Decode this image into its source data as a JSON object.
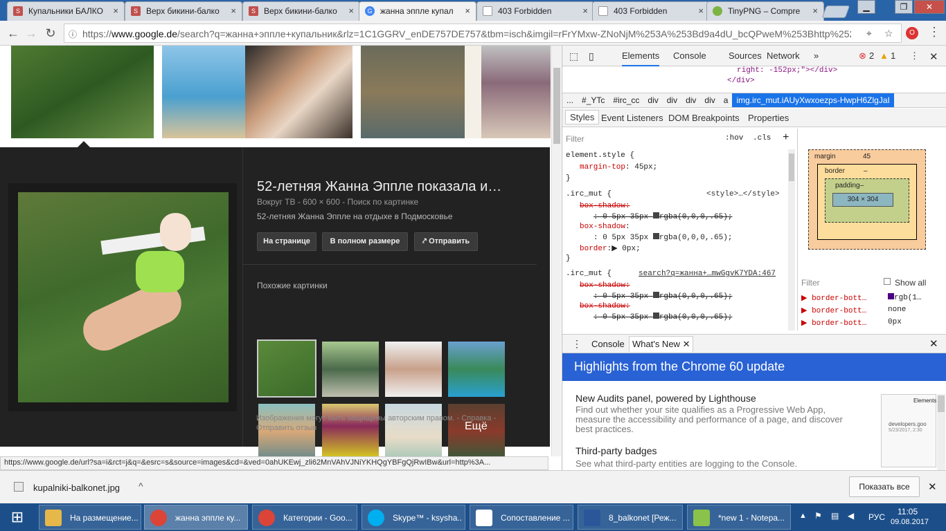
{
  "browser": {
    "tabs": [
      {
        "label": "Купальники БАЛКО",
        "fav_color": "#c0504d"
      },
      {
        "label": "Верх бикини-балко",
        "fav_color": "#c0504d"
      },
      {
        "label": "Верх бикини-балко",
        "fav_color": "#c0504d"
      },
      {
        "label": "жанна эппле купал",
        "fav_color": "#4285f4"
      },
      {
        "label": "403 Forbidden",
        "fav_color": "#ffffff"
      },
      {
        "label": "403 Forbidden",
        "fav_color": "#ffffff"
      },
      {
        "label": "TinyPNG – Compre",
        "fav_color": "#7cb342"
      }
    ],
    "tab_close": "×",
    "url_prefix": "https://",
    "url_host": "www.google.de",
    "url_rest": "/search?q=жанна+эппле+купальник&rlz=1C1GGRV_enDE757DE757&tbm=isch&imgil=rFrYMxw-ZNoNjM%253A%253Bd9a4dU_bcQPweM%253Bhttp%252..."
  },
  "google": {
    "panel": {
      "title": "52-летняя Жанна Эппле показала и…",
      "subtitle": "Вокруг ТВ - 600 × 600 - Поиск по картинке",
      "description": "52-летняя Жанна Эппле на отдыхе в Подмосковье",
      "btn_visit": "На странице",
      "btn_full": "В полном размере",
      "btn_share": "Отправить",
      "similar_heading": "Похожие картинки",
      "more_label": "Ещё",
      "footer": "Изображения могут быть защищены авторским правом. - Справка - Отправить отзыв"
    },
    "status_url": "https://www.google.de/url?sa=i&rct=j&q=&esrc=s&source=images&cd=&ved=0ahUKEwj_zli62MnVAhVJNiYKHQgYBFgQjRwIBw&url=http%3A..."
  },
  "devtools": {
    "tabs": [
      "Elements",
      "Console",
      "Sources",
      "Network"
    ],
    "more": "»",
    "errors": "2",
    "warnings": "1",
    "dom_line1": "right: -152px;\"></div>",
    "dom_line2": "</div>",
    "breadcrumbs": [
      "...",
      "#_YTc",
      "#irc_cc",
      "div",
      "div",
      "div",
      "div",
      "a"
    ],
    "breadcrumb_selected": "img.irc_mut.iAUyXwxoezps-HwpH6ZlgJaI",
    "subtabs": [
      "Styles",
      "Event Listeners",
      "DOM Breakpoints",
      "Properties"
    ],
    "filter": "Filter",
    "hov": ":hov",
    "cls": ".cls",
    "styles": {
      "rule1_selector": "element.style {",
      "rule1_prop": "margin-top",
      "rule1_val": ": 45px;",
      "close": "}",
      "rule2_selector": ".irc_mut {",
      "rule2_source": "<style>…</style>",
      "box_shadow": "box-shadow",
      "shadow_val": ": 0 5px 35px ",
      "rgba": "rgba(0,0,0,.65);",
      "border": "border",
      "border_val": ":▶ 0px;",
      "rule3_selector": ".irc_mut {",
      "rule3_source": "search?q=жанна+…mwGgvK7YDA:467"
    },
    "boxmodel": {
      "margin_label": "margin",
      "margin_val": "45",
      "border_label": "border",
      "padding_label": "padding–",
      "content": "304 × 304",
      "dash": "–"
    },
    "computed": {
      "filter": "Filter",
      "show_all": "Show all",
      "rows": [
        {
          "prop": "border-bott…",
          "val": "rgb(1…"
        },
        {
          "prop": "border-bott…",
          "val": "none"
        },
        {
          "prop": "border-bott…",
          "val": "0px"
        }
      ]
    },
    "drawer": {
      "tabs": [
        "Console",
        "What's New"
      ],
      "banner": "Highlights from the Chrome 60 update",
      "items": [
        {
          "title": "New Audits panel, powered by Lighthouse",
          "desc": "Find out whether your site qualifies as a Progressive Web App, measure the accessibility and performance of a page, and discover best practices."
        },
        {
          "title": "Third-party badges",
          "desc": "See what third-party entities are logging to the Console."
        }
      ],
      "thumb_label": "Elements",
      "thumb_site": "developers.goo",
      "thumb_date": "5/23/2017, 2:30"
    }
  },
  "download": {
    "filename": "kupalniki-balkonet.jpg",
    "show_all": "Показать все"
  },
  "taskbar": {
    "items": [
      {
        "label": "На размещение...",
        "icon_color": "#e6b84a"
      },
      {
        "label": "жанна эппле ку...",
        "icon_color": "#db4437"
      },
      {
        "label": "Категории - Goo...",
        "icon_color": "#db4437"
      },
      {
        "label": "Skype™ - ksysha...",
        "icon_color": "#00aff0"
      },
      {
        "label": "Сопоставление ...",
        "icon_color": "#ffffff"
      },
      {
        "label": "8_balkonet [Реж...",
        "icon_color": "#2b579a"
      },
      {
        "label": "*new 1 - Notepa...",
        "icon_color": "#8bc34a"
      }
    ],
    "lang": "РУС",
    "time": "11:05",
    "date": "09.08.2017"
  }
}
